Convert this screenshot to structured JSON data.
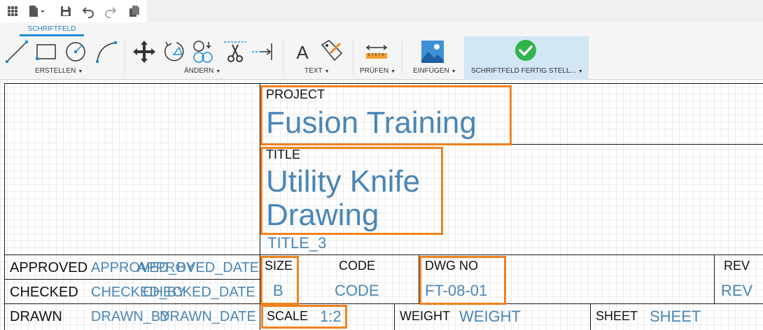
{
  "ribbon": {
    "active_tab": "SCHRIFTFELD",
    "groups": {
      "create": "ERSTELLEN",
      "modify": "ÄNDERN",
      "text": "TEXT",
      "check": "PRÜFEN",
      "insert": "EINFÜGEN",
      "finish": "SCHRIFTFELD FERTIG STELL..."
    },
    "icons": [
      "line-icon",
      "rectangle-icon",
      "circle-icon",
      "arc-icon",
      "move-icon",
      "rotate-icon",
      "copy-icon",
      "trim-icon",
      "extend-icon",
      "text-icon",
      "text-edit-icon",
      "measure-icon",
      "insert-image-icon",
      "checkmark-icon"
    ]
  },
  "title_block": {
    "project_label": "PROJECT",
    "project_value": "Fusion Training",
    "title_label": "TITLE",
    "title_value_line1": "Utility Knife",
    "title_value_line2": "Drawing",
    "title3_value": "TITLE_3",
    "approved_label": "APPROVED",
    "approved_by": "APPROVED_BY",
    "approved_date": "APPROVED_DATE",
    "checked_label": "CHECKED",
    "checked_by": "CHECKED_BY",
    "checked_date": "CHECKED_DATE",
    "drawn_label": "DRAWN",
    "drawn_by": "DRAWN_BY",
    "drawn_date": "DRAWN_DATE",
    "size_label": "SIZE",
    "size_value": "B",
    "code_label": "CODE",
    "code_value": "CODE",
    "dwg_label": "DWG NO",
    "dwg_value": "FT-08-01",
    "rev_label": "REV",
    "rev_value": "REV",
    "scale_label": "SCALE",
    "scale_value": "1:2",
    "weight_label": "WEIGHT",
    "weight_value": "WEIGHT",
    "sheet_label": "SHEET",
    "sheet_value": "SHEET"
  },
  "colors": {
    "field_value": "#4a86b4",
    "highlight": "#f0821e",
    "accent": "#1f8fd9",
    "finish_bg": "#d3e6f4",
    "check_green": "#2fb44a"
  }
}
